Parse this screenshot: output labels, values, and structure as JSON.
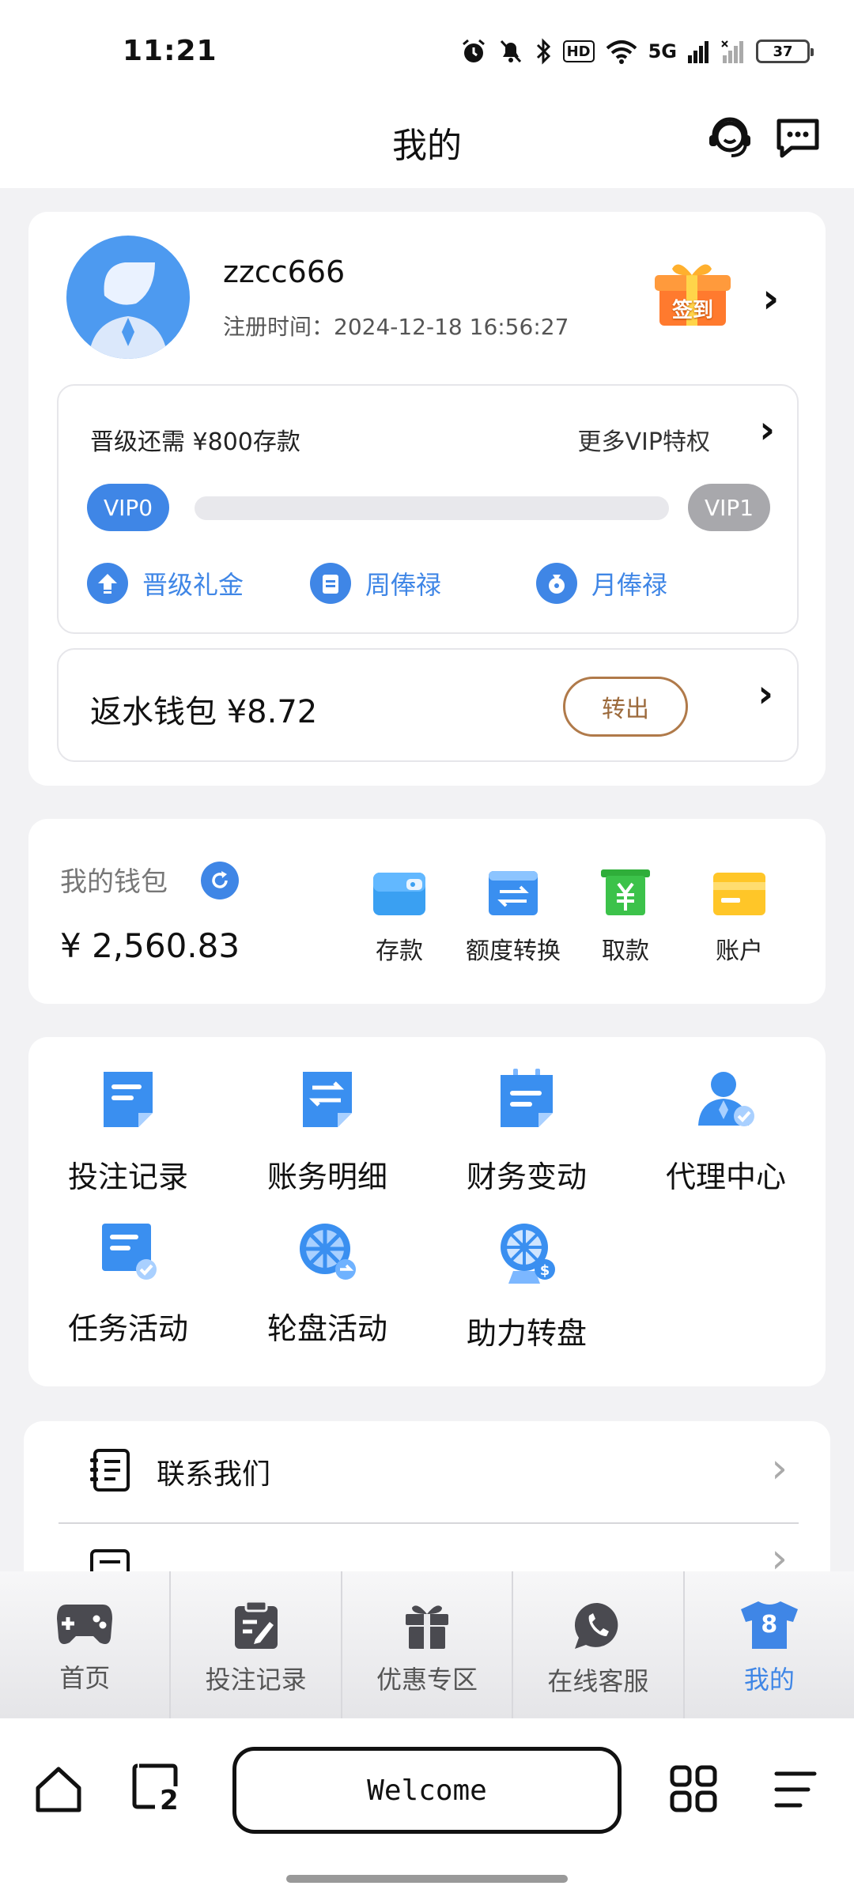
{
  "status_bar": {
    "time": "11:21",
    "network": "5G",
    "hd_label": "HD",
    "battery": "37"
  },
  "header": {
    "title": "我的"
  },
  "profile": {
    "username": "zzcc666",
    "register_time": "注册时间：2024-12-18 16:56:27",
    "signin_label": "签到"
  },
  "vip": {
    "upgrade_text": "晋级还需 ¥800存款",
    "more_text": "更多VIP特权",
    "current_level": "VIP0",
    "next_level": "VIP1",
    "progress": 0,
    "perks": [
      "晋级礼金",
      "周俸禄",
      "月俸禄"
    ]
  },
  "rebate": {
    "text": "返水钱包 ¥8.72",
    "button": "转出"
  },
  "wallet": {
    "title": "我的钱包",
    "amount": "¥ 2,560.83",
    "actions": [
      "存款",
      "额度转换",
      "取款",
      "账户"
    ]
  },
  "features": [
    "投注记录",
    "账务明细",
    "财务变动",
    "代理中心",
    "任务活动",
    "轮盘活动",
    "助力转盘"
  ],
  "menu": {
    "contact": "联系我们"
  },
  "tabbar": {
    "items": [
      "首页",
      "投注记录",
      "优惠专区",
      "在线客服",
      "我的"
    ],
    "active_badge": "8"
  },
  "browser": {
    "welcome": "Welcome",
    "tab_count": "2"
  },
  "colors": {
    "accent": "#3f86e6",
    "vip_next": "#a8a8ac",
    "transfer": "#b07a4a"
  }
}
